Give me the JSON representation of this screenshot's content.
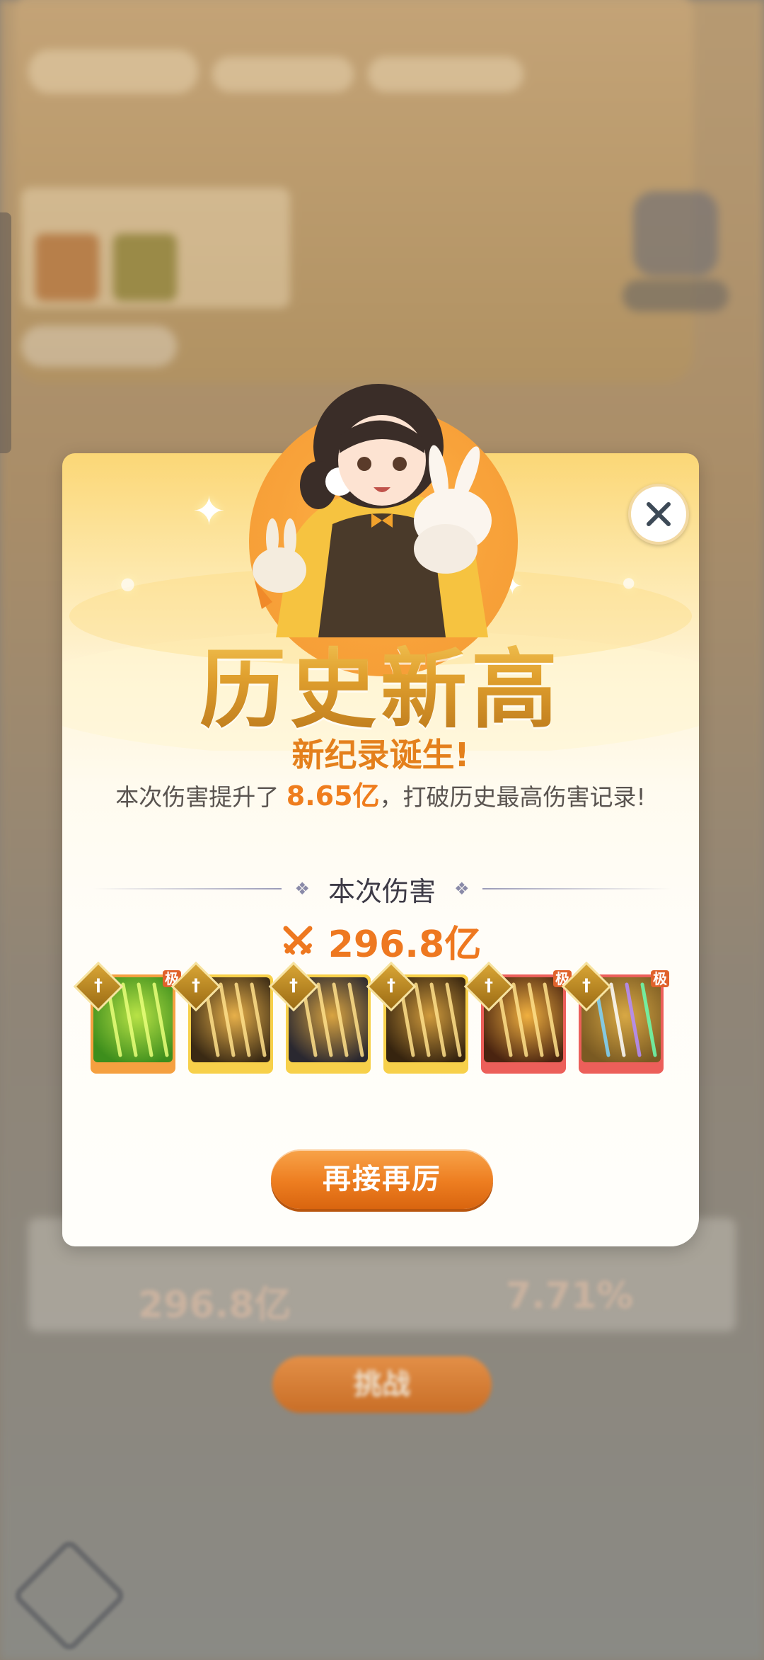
{
  "background": {
    "damage_value": "296.8亿",
    "percent_value": "7.71%",
    "button_label": "挑战"
  },
  "dialog": {
    "title": "历史新高",
    "subtitle": "新纪录诞生!",
    "desc_prefix": "本次伤害提升了 ",
    "desc_highlight": "8.65亿",
    "desc_suffix": "，打破历史最高伤害记录!",
    "section_label": "本次伤害",
    "damage_value": "296.8亿",
    "skills": [
      {
        "name": "skill-green-burst",
        "tag": "极",
        "frame": "#f5a040",
        "colors": [
          "#3d8e1c",
          "#b8e246"
        ]
      },
      {
        "name": "skill-gold-blades-1",
        "tag": "",
        "frame": "#f7d04a",
        "colors": [
          "#3a2a14",
          "#e7b04a"
        ]
      },
      {
        "name": "skill-gold-blue-shards",
        "tag": "",
        "frame": "#f7d04a",
        "colors": [
          "#2a2830",
          "#d9a441"
        ]
      },
      {
        "name": "skill-gold-blades-2",
        "tag": "",
        "frame": "#f7d04a",
        "colors": [
          "#36240f",
          "#cf9a3c"
        ]
      },
      {
        "name": "skill-gold-blades-3",
        "tag": "极",
        "frame": "#ec5f5a",
        "colors": [
          "#4a2410",
          "#f0b040"
        ]
      },
      {
        "name": "skill-rainbow-comet",
        "tag": "极",
        "frame": "#ec5f5a",
        "colors": [
          "#7a5a22",
          "#d8a844"
        ]
      }
    ],
    "badge_glyph": "†",
    "close_icon": "close-icon",
    "cta_label": "再接再厉"
  }
}
